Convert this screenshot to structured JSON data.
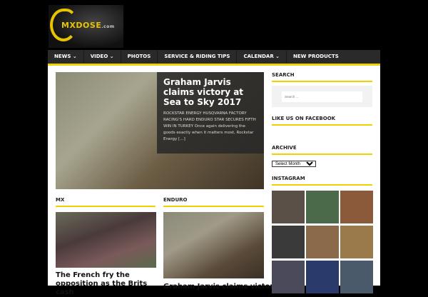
{
  "logo": {
    "text": "MXDOSE",
    ".com": ".com",
    "suffix": ".com"
  },
  "nav": [
    "NEWS ⌄",
    "VIDEO ⌄",
    "PHOTOS",
    "SERVICE & RIDING TIPS",
    "CALENDAR ⌄",
    "NEW PRODUCTS"
  ],
  "hero": {
    "title": "Graham Jarvis claims victory at Sea to Sky 2017",
    "excerpt": "ROCKSTAR ENERGY HUSQVARNA FACTORY RACING'S HARD ENDURO STAR SECURES FIFTH WIN IN TURKEY Once again delivering the goods exactly when it matters most, Rockstar Energy […]"
  },
  "sections": [
    {
      "label": "MX",
      "post_title": "The French fry the opposition as the Brits cash"
    },
    {
      "label": "ENDURO",
      "post_title": "Graham Jarvis claims victory"
    }
  ],
  "sidebar": {
    "search_title": "SEARCH",
    "search_placeholder": "Search ...",
    "facebook_title": "LIKE US ON FACEBOOK",
    "archive_title": "ARCHIVE",
    "archive_select": "Select Month",
    "instagram_title": "INSTAGRAM"
  },
  "colors": {
    "accent": "#f0d200",
    "nav": "#2a2a2a"
  }
}
